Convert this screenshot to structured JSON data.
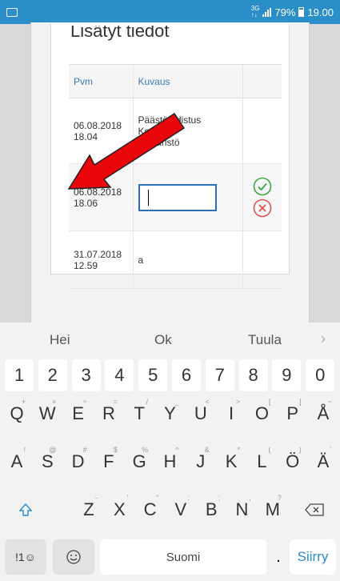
{
  "status": {
    "net_top": "3G",
    "net_bottom": "↑↓",
    "battery": "79%",
    "time": "19.00"
  },
  "card": {
    "title": "Lisätyt tiedot"
  },
  "table": {
    "headers": [
      "Pvm",
      "Kuvaus",
      ""
    ],
    "rows": [
      {
        "date": "06.08.2018",
        "time": "18.04",
        "desc": [
          "Päästötodistus",
          "Konto ja",
          "ympäristö"
        ]
      },
      {
        "date": "06.08.2018",
        "time": "18.06",
        "desc": [
          ""
        ]
      },
      {
        "date": "31.07.2018",
        "time": "12.59",
        "desc": [
          "a"
        ]
      }
    ]
  },
  "keyboard": {
    "suggestions": [
      "Hei",
      "Ok",
      "Tuula"
    ],
    "numbers": [
      "1",
      "2",
      "3",
      "4",
      "5",
      "6",
      "7",
      "8",
      "9",
      "0"
    ],
    "row1": [
      [
        "Q",
        "+"
      ],
      [
        "W",
        "×"
      ],
      [
        "E",
        "÷"
      ],
      [
        "R",
        "="
      ],
      [
        "T",
        "/"
      ],
      [
        "Y",
        "_"
      ],
      [
        "U",
        "<"
      ],
      [
        "I",
        ">"
      ],
      [
        "O",
        "["
      ],
      [
        "P",
        "]"
      ],
      [
        "Å",
        "~"
      ]
    ],
    "row2": [
      [
        "A",
        "!"
      ],
      [
        "S",
        "@"
      ],
      [
        "D",
        "#"
      ],
      [
        "F",
        "$"
      ],
      [
        "G",
        "%"
      ],
      [
        "H",
        "^"
      ],
      [
        "J",
        "&"
      ],
      [
        "K",
        "*"
      ],
      [
        "L",
        "("
      ],
      [
        "Ö",
        ")"
      ],
      [
        "Ä",
        "`"
      ]
    ],
    "row3": [
      [
        "Z",
        "-"
      ],
      [
        "X",
        "'"
      ],
      [
        "C",
        "\""
      ],
      [
        "V",
        ":"
      ],
      [
        "B",
        ";"
      ],
      [
        "N",
        ","
      ],
      [
        "M",
        "?"
      ]
    ],
    "sym_label": "!1☺",
    "space_label": "Suomi",
    "dot_label": ".",
    "go_label": "Siirry"
  },
  "colors": {
    "status_bar": "#2a8ec8",
    "check": "#3ba845",
    "cross": "#d9534f",
    "arrow": "#e8060a"
  }
}
